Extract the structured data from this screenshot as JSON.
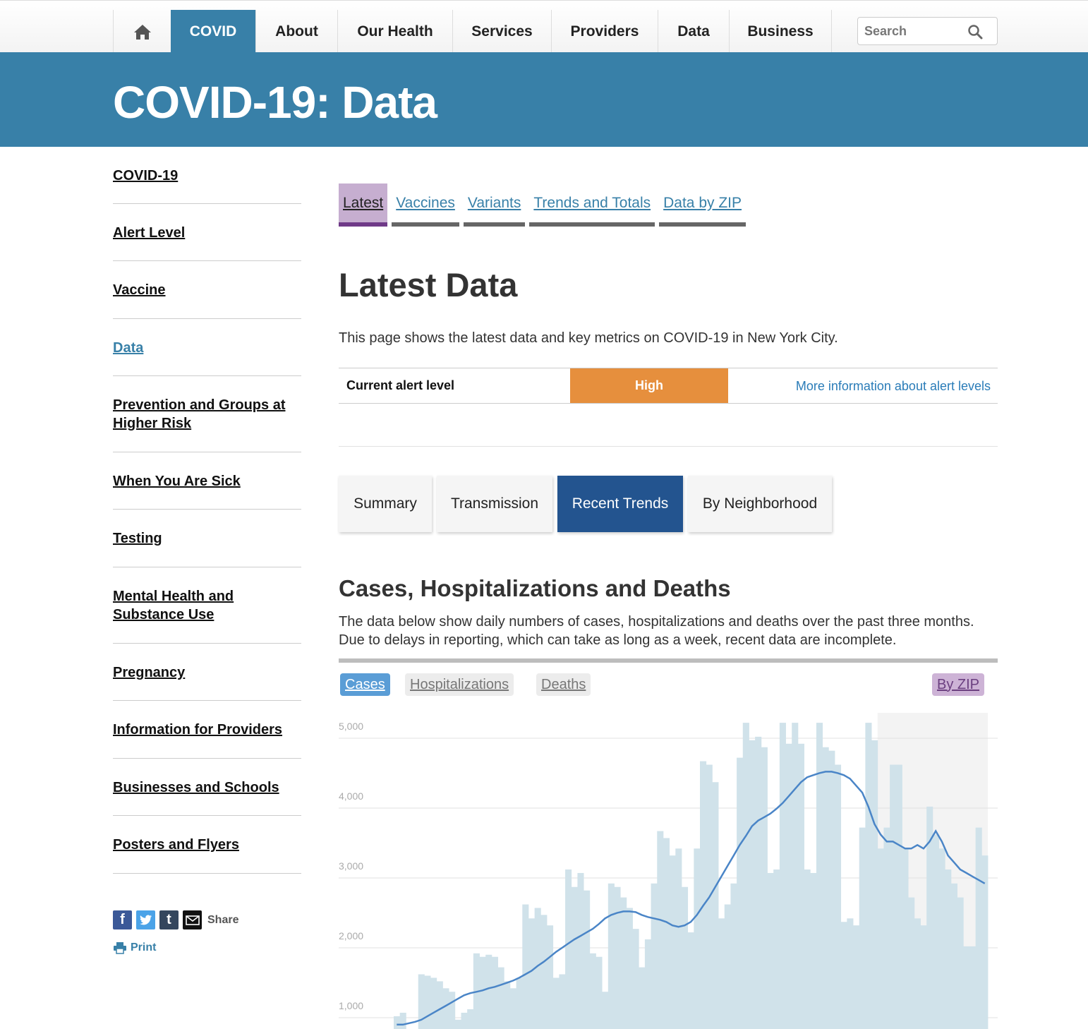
{
  "nav": {
    "home_icon": "home-icon",
    "items": [
      {
        "label": "COVID",
        "active": true
      },
      {
        "label": "About"
      },
      {
        "label": "Our Health"
      },
      {
        "label": "Services"
      },
      {
        "label": "Providers"
      },
      {
        "label": "Data"
      },
      {
        "label": "Business"
      }
    ],
    "search_placeholder": "Search",
    "search_icon": "search-icon"
  },
  "banner": {
    "title": "COVID-19: Data"
  },
  "sidebar": {
    "items": [
      {
        "label": "COVID-19"
      },
      {
        "label": "Alert Level"
      },
      {
        "label": "Vaccine"
      },
      {
        "label": "Data",
        "active": true
      },
      {
        "label": "Prevention and Groups at Higher Risk"
      },
      {
        "label": "When You Are Sick"
      },
      {
        "label": "Testing"
      },
      {
        "label": "Mental Health and Substance Use"
      },
      {
        "label": "Pregnancy"
      },
      {
        "label": "Information for Providers"
      },
      {
        "label": "Businesses and Schools"
      },
      {
        "label": "Posters and Flyers"
      }
    ],
    "share_label": "Share",
    "print_label": "Print"
  },
  "subtabs": [
    {
      "label": "Latest",
      "active": true
    },
    {
      "label": "Vaccines"
    },
    {
      "label": "Variants"
    },
    {
      "label": "Trends and Totals"
    },
    {
      "label": "Data by ZIP"
    }
  ],
  "main": {
    "title": "Latest Data",
    "intro": "This page shows the latest data and key metrics on COVID-19 in New York City.",
    "alert": {
      "label": "Current alert level",
      "level": "High",
      "level_color": "#e68f3d",
      "more_link": "More information about alert levels"
    },
    "feature_tabs": [
      {
        "label": "Summary"
      },
      {
        "label": "Transmission"
      },
      {
        "label": "Recent Trends",
        "active": true
      },
      {
        "label": "By Neighborhood"
      }
    ],
    "section_title": "Cases, Hospitalizations and Deaths",
    "section_desc": "The data below show daily numbers of cases, hospitalizations and deaths over the past three months. Due to delays in reporting, which can take as long as a week, recent data are incomplete.",
    "chart_toggles": [
      {
        "label": "Cases",
        "active": true
      },
      {
        "label": "Hospitalizations"
      },
      {
        "label": "Deaths"
      }
    ],
    "zip_toggle": "By ZIP"
  },
  "chart_data": {
    "type": "bar",
    "title": "",
    "xlabel": "",
    "ylabel": "",
    "ylim": [
      0,
      5000
    ],
    "yticks": [
      1000,
      2000,
      3000,
      4000,
      5000
    ],
    "ytick_labels": [
      "1,000",
      "2,000",
      "3,000",
      "4,000",
      "5,000"
    ],
    "incomplete_region_start_index": 79,
    "colors": {
      "bars": "#d0e2ea",
      "average": "#4a85c7",
      "secondary": "#aeaeae",
      "incomplete": "#f3f3f3"
    },
    "series": [
      {
        "name": "Cases",
        "kind": "bar",
        "values": [
          900,
          950,
          700,
          700,
          1500,
          1480,
          1450,
          1400,
          1300,
          1250,
          850,
          950,
          1000,
          1800,
          1750,
          1780,
          1750,
          1600,
          1400,
          1300,
          1450,
          2500,
          2300,
          2450,
          2350,
          2200,
          1450,
          1500,
          3000,
          2750,
          2950,
          2700,
          1800,
          1750,
          1250,
          2800,
          2750,
          2600,
          2450,
          2150,
          1600,
          2000,
          2800,
          3550,
          3450,
          3200,
          3300,
          2750,
          2100,
          3300,
          4550,
          4500,
          4250,
          2300,
          2500,
          2800,
          4600,
          5100,
          4850,
          4900,
          4750,
          2950,
          3000,
          5100,
          4800,
          5100,
          4800,
          3000,
          2950,
          5100,
          4750,
          4700,
          4500,
          2250,
          2300,
          2200,
          3600,
          5100,
          4850,
          3300,
          3600,
          4500,
          4500,
          3300,
          2600,
          2300,
          2200,
          3900,
          3500,
          3300,
          3000,
          2800,
          2600,
          1900,
          1900,
          3600,
          3200
        ]
      },
      {
        "name": "7-day average",
        "kind": "line",
        "values": [
          780,
          780,
          800,
          820,
          850,
          900,
          950,
          1000,
          1050,
          1100,
          1150,
          1200,
          1230,
          1250,
          1270,
          1300,
          1320,
          1350,
          1380,
          1410,
          1450,
          1500,
          1550,
          1620,
          1680,
          1750,
          1820,
          1880,
          1940,
          2000,
          2050,
          2100,
          2150,
          2220,
          2300,
          2350,
          2380,
          2400,
          2400,
          2390,
          2350,
          2320,
          2300,
          2280,
          2250,
          2200,
          2180,
          2200,
          2250,
          2350,
          2480,
          2600,
          2750,
          2900,
          3050,
          3200,
          3350,
          3480,
          3620,
          3700,
          3750,
          3800,
          3870,
          3950,
          4050,
          4150,
          4250,
          4320,
          4350,
          4380,
          4400,
          4400,
          4380,
          4350,
          4300,
          4200,
          4100,
          3900,
          3650,
          3500,
          3400,
          3400,
          3350,
          3300,
          3300,
          3350,
          3300,
          3400,
          3550,
          3400,
          3200,
          3100,
          3000,
          2950,
          2900,
          2850,
          2800
        ]
      }
    ]
  }
}
